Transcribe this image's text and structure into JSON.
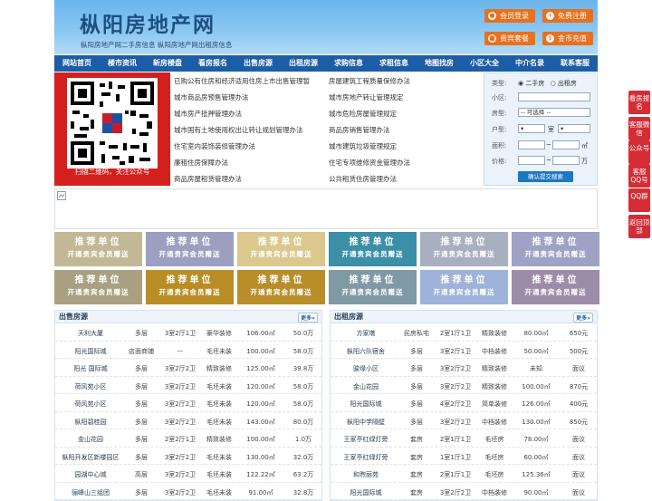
{
  "site": {
    "title": "枞阳房地产网",
    "subtitle": "枞阳房地产网二手房信息    枞阳房地产网出租房信息"
  },
  "header_buttons": [
    "会员登录",
    "免费注册",
    "贵宾套餐",
    "金币充值"
  ],
  "nav": [
    "网站首页",
    "楼市资讯",
    "新房楼盘",
    "看房报名",
    "出售房源",
    "出租房源",
    "求购信息",
    "求租信息",
    "地图找房",
    "小区大全",
    "中介名录",
    "联系客服"
  ],
  "qr_caption": "扫描二维码，关注公众号",
  "links_left": [
    "已购公有住房和经济适用住房上市出售管理暂",
    "城市商品房预售管理办法",
    "城市房产抵押管理办法",
    "城市国有土地使用权出让转让规划管理办法",
    "住宅室内装饰装修管理办法",
    "廉租住房保障办法",
    "商品房屋租赁管理办法"
  ],
  "links_right": [
    "房屋建筑工程质量保修办法",
    "城市房地产转让管理规定",
    "城市危险房屋管理规定",
    "商品房销售管理办法",
    "城市建筑垃圾管理规定",
    "住宅专项维修资金管理办法",
    "公共租赁住房管理办法"
  ],
  "search": {
    "type_label": "类型:",
    "type_opts": [
      "二手房",
      "出租房"
    ],
    "district_label": "小区:",
    "house_label": "房型:",
    "house_select": "-- 可选择 --",
    "layout_label": "户型:",
    "room_unit": "室",
    "area_label": "面积:",
    "area_unit": "㎡",
    "price_label": "价格:",
    "price_unit": "万",
    "submit": "确认提交搜索"
  },
  "ad_cell": {
    "line1": "推荐单位",
    "line2": "开通贵宾会员赠送"
  },
  "ad_colors": [
    "#c3b896",
    "#9c9fc0",
    "#dac88e",
    "#3b8fa6",
    "#a8b0c0",
    "#9ea2c5",
    "#a8a080",
    "#b98d25",
    "#b88e2b",
    "#7f9aa4",
    "#9fb2da",
    "#9d8ca8"
  ],
  "sale": {
    "title": "出售房源",
    "more": "更多»",
    "rows": [
      [
        "天利大厦",
        "多层",
        "3室2厅1卫",
        "豪华装修",
        "106.00㎡",
        "50.0万"
      ],
      [
        "阳光国际城",
        "店面商铺",
        "—",
        "毛坯未装",
        "100.00㎡",
        "58.0万"
      ],
      [
        "阳光 国际城",
        "多层",
        "3室2厅2卫",
        "精致装修",
        "125.00㎡",
        "39.8万"
      ],
      [
        "荷风苑小区",
        "多层",
        "3室2厅2卫",
        "毛坯未装",
        "120.00㎡",
        "58.0万"
      ],
      [
        "荷风苑小区",
        "多层",
        "3室2厅2卫",
        "毛坯未装",
        "120.00㎡",
        "58.0万"
      ],
      [
        "枞阳碧桂园",
        "多层",
        "3室2厅2卫",
        "毛坯未装",
        "143.00㎡",
        "80.0万"
      ],
      [
        "金山花园",
        "多层",
        "2室2厅1卫",
        "精致装修",
        "100.00㎡",
        "1.0万"
      ],
      [
        "枞阳开发区新楼园区",
        "多层",
        "3室2厅2卫",
        "毛坯未装",
        "130.00㎡",
        "32.0万"
      ],
      [
        "园湖中心城",
        "高层",
        "3室2厅2卫",
        "毛坯未装",
        "122.22㎡",
        "63.2万"
      ],
      [
        "骊峰山三组团",
        "多层",
        "3室2厅2卫",
        "毛坯未装",
        "91.00㎡",
        "32.8万"
      ]
    ]
  },
  "rent": {
    "title": "出租房源",
    "more": "更多»",
    "rows": [
      [
        "方家墩",
        "民房私宅",
        "2室1厅1卫",
        "精致装修",
        "80.00㎡",
        "650元"
      ],
      [
        "枞阳六队宿舍",
        "多层",
        "3室2厅1卫",
        "中档装修",
        "50.00㎡",
        "500元"
      ],
      [
        "骏缘小区",
        "多层",
        "3室2厅2卫",
        "精致装修",
        "未知",
        "面议"
      ],
      [
        "金山花园",
        "多层",
        "3室2厅2卫",
        "精致装修",
        "100.00㎡",
        "870元"
      ],
      [
        "阳光国际城",
        "多层",
        "4室2厅2卫",
        "简单装修",
        "126.00㎡",
        "400元"
      ],
      [
        "枞阳中学隔壁",
        "多层",
        "3室2厅2卫",
        "中档装修",
        "130.00㎡",
        "850元"
      ],
      [
        "王家亭红绿灯旁",
        "套房",
        "2室1厅1卫",
        "毛坯房",
        "78.00㎡",
        "面议"
      ],
      [
        "王家亭红绿灯旁",
        "套房",
        "1室1厅1卫",
        "毛坯房",
        "60.00㎡",
        "面议"
      ],
      [
        "和煦丽苑",
        "套房",
        "2室1厅1卫",
        "毛坯房",
        "125.36㎡",
        "面议"
      ],
      [
        "阳光国际城",
        "套房",
        "3室2厅2卫",
        "中档装修",
        "90.00㎡",
        "面议"
      ]
    ]
  },
  "side_tabs": [
    "看房报名",
    "客服微信",
    "公众号",
    "客服QQ号",
    "QQ群",
    "返回顶部"
  ]
}
